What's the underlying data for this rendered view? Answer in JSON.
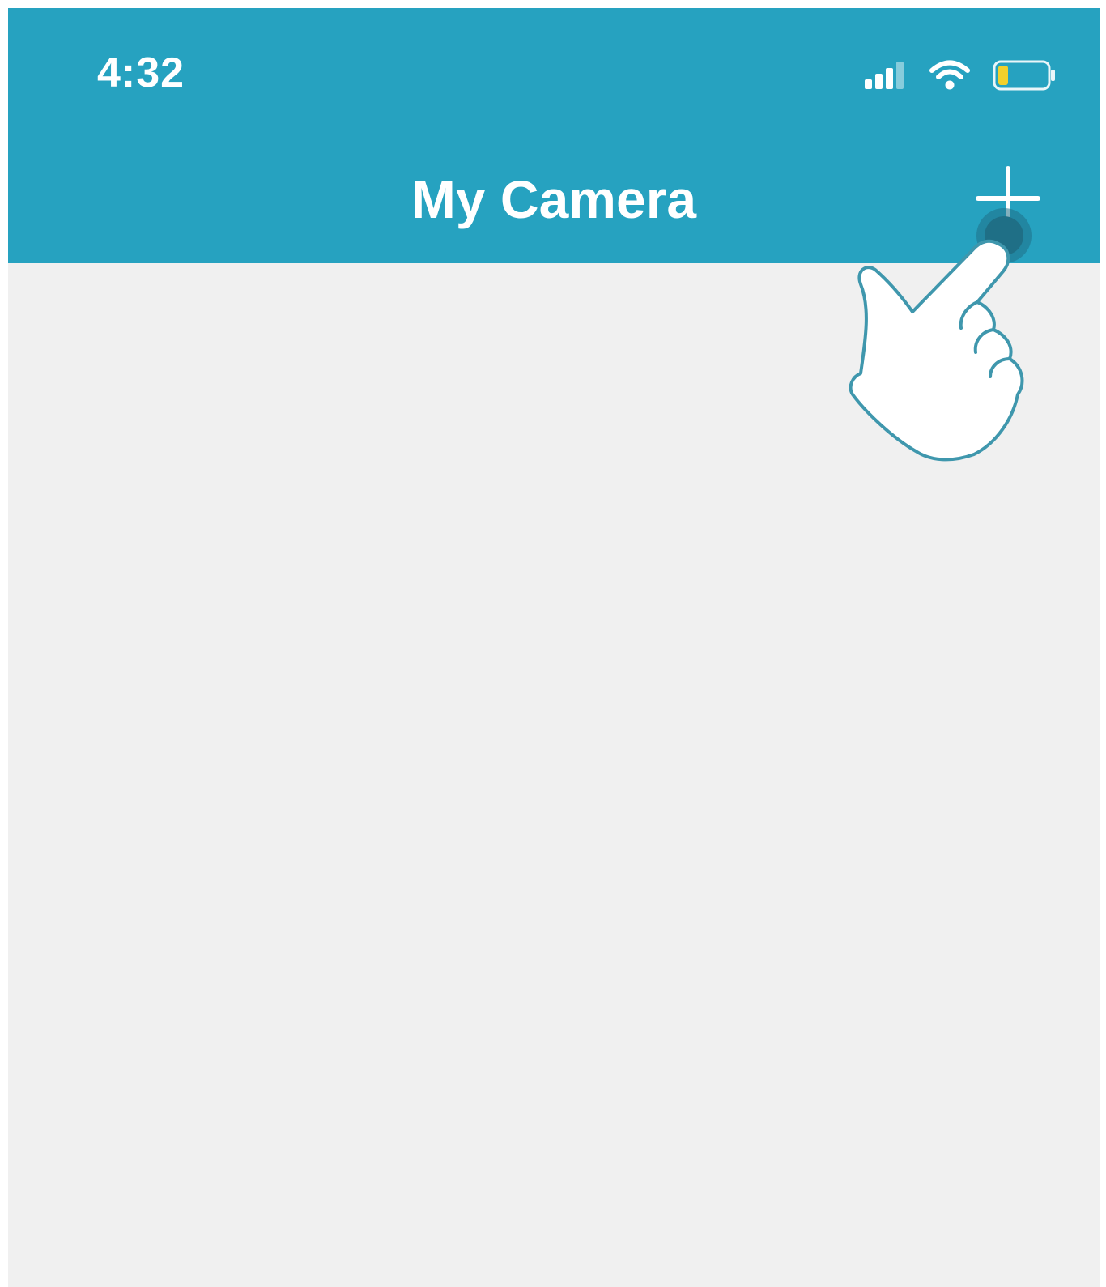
{
  "colors": {
    "header": "#26a2c0",
    "content_background": "#f0f0f0",
    "tap_indicator": "#1f6f86",
    "battery_level": "#f2d02b"
  },
  "status_bar": {
    "time": "4:32",
    "icons": [
      "signal-icon",
      "wifi-icon",
      "battery-icon"
    ]
  },
  "nav_bar": {
    "title": "My Camera",
    "add_icon": "plus-icon"
  },
  "overlay": {
    "icon": "pointing-hand-icon"
  }
}
